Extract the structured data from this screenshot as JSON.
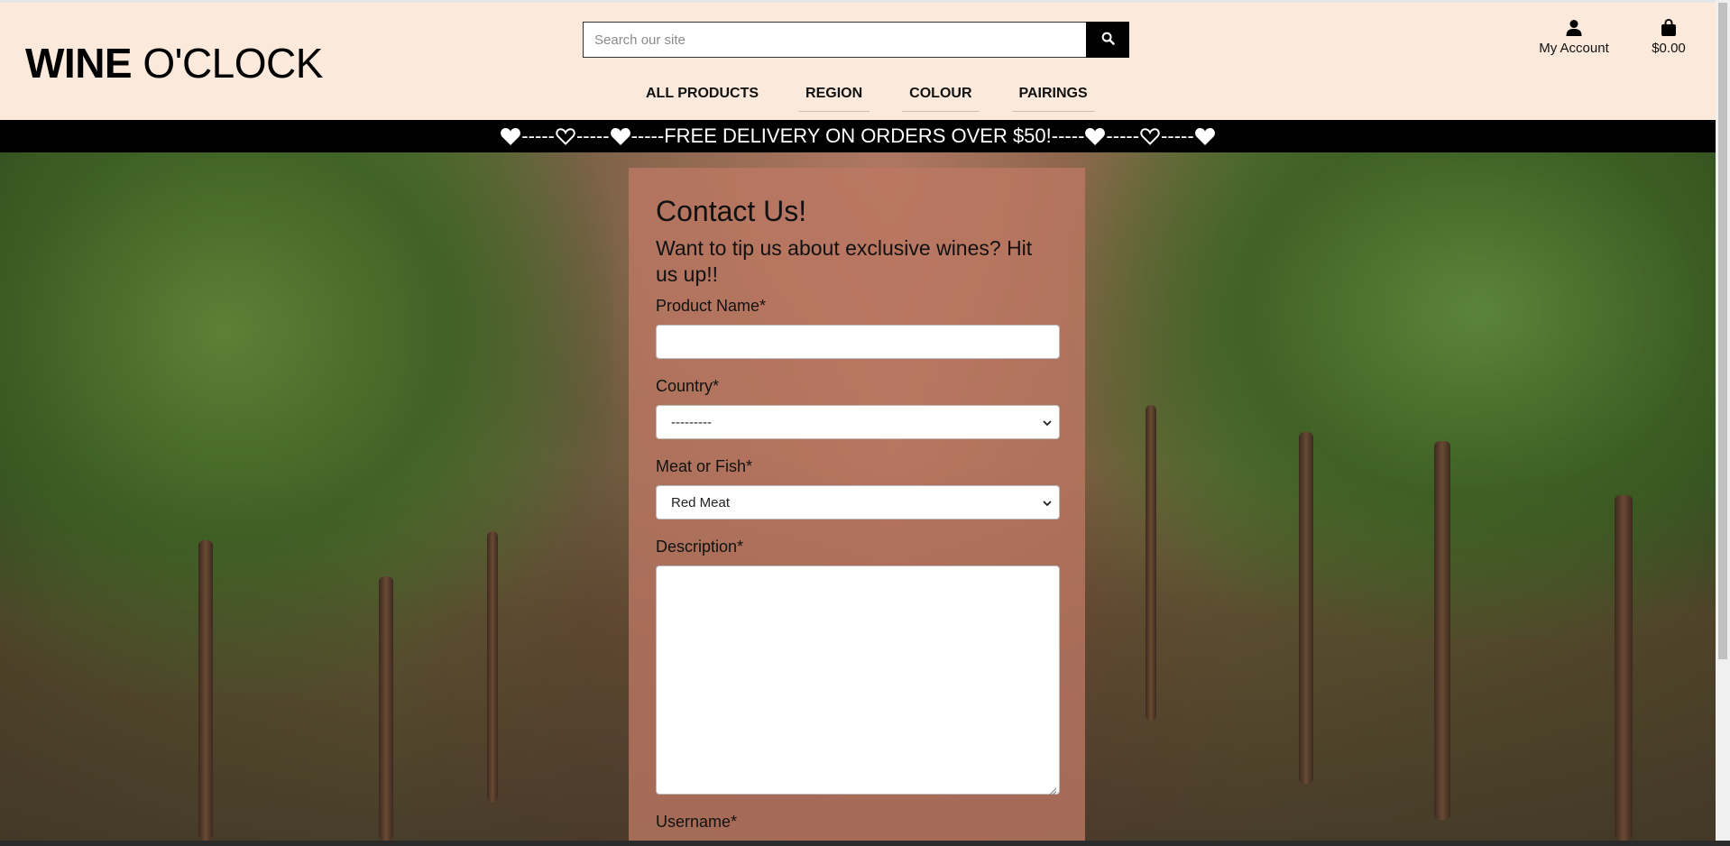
{
  "brand": {
    "bold": "WINE",
    "light": "O'CLOCK"
  },
  "search": {
    "placeholder": "Search our site",
    "icon": "search-icon"
  },
  "nav": [
    "ALL PRODUCTS",
    "REGION",
    "COLOUR",
    "PAIRINGS"
  ],
  "account": {
    "label": "My Account",
    "icon": "user-icon"
  },
  "cart": {
    "label": "$0.00",
    "icon": "shopping-bag-icon"
  },
  "banner": {
    "text": "FREE DELIVERY ON ORDERS OVER $50!",
    "separator": "-----"
  },
  "form": {
    "title": "Contact Us!",
    "subtitle": "Want to tip us about exclusive wines? Hit us up!!",
    "fields": {
      "product_name": {
        "label": "Product Name*",
        "value": ""
      },
      "country": {
        "label": "Country*",
        "selected": "---------"
      },
      "meat_or_fish": {
        "label": "Meat or Fish*",
        "selected": "Red Meat"
      },
      "description": {
        "label": "Description*",
        "value": ""
      },
      "username": {
        "label": "Username*"
      }
    }
  },
  "colors": {
    "header_bg": "#fbeadb",
    "banner_bg": "#000000",
    "form_panel": "#be7864"
  }
}
